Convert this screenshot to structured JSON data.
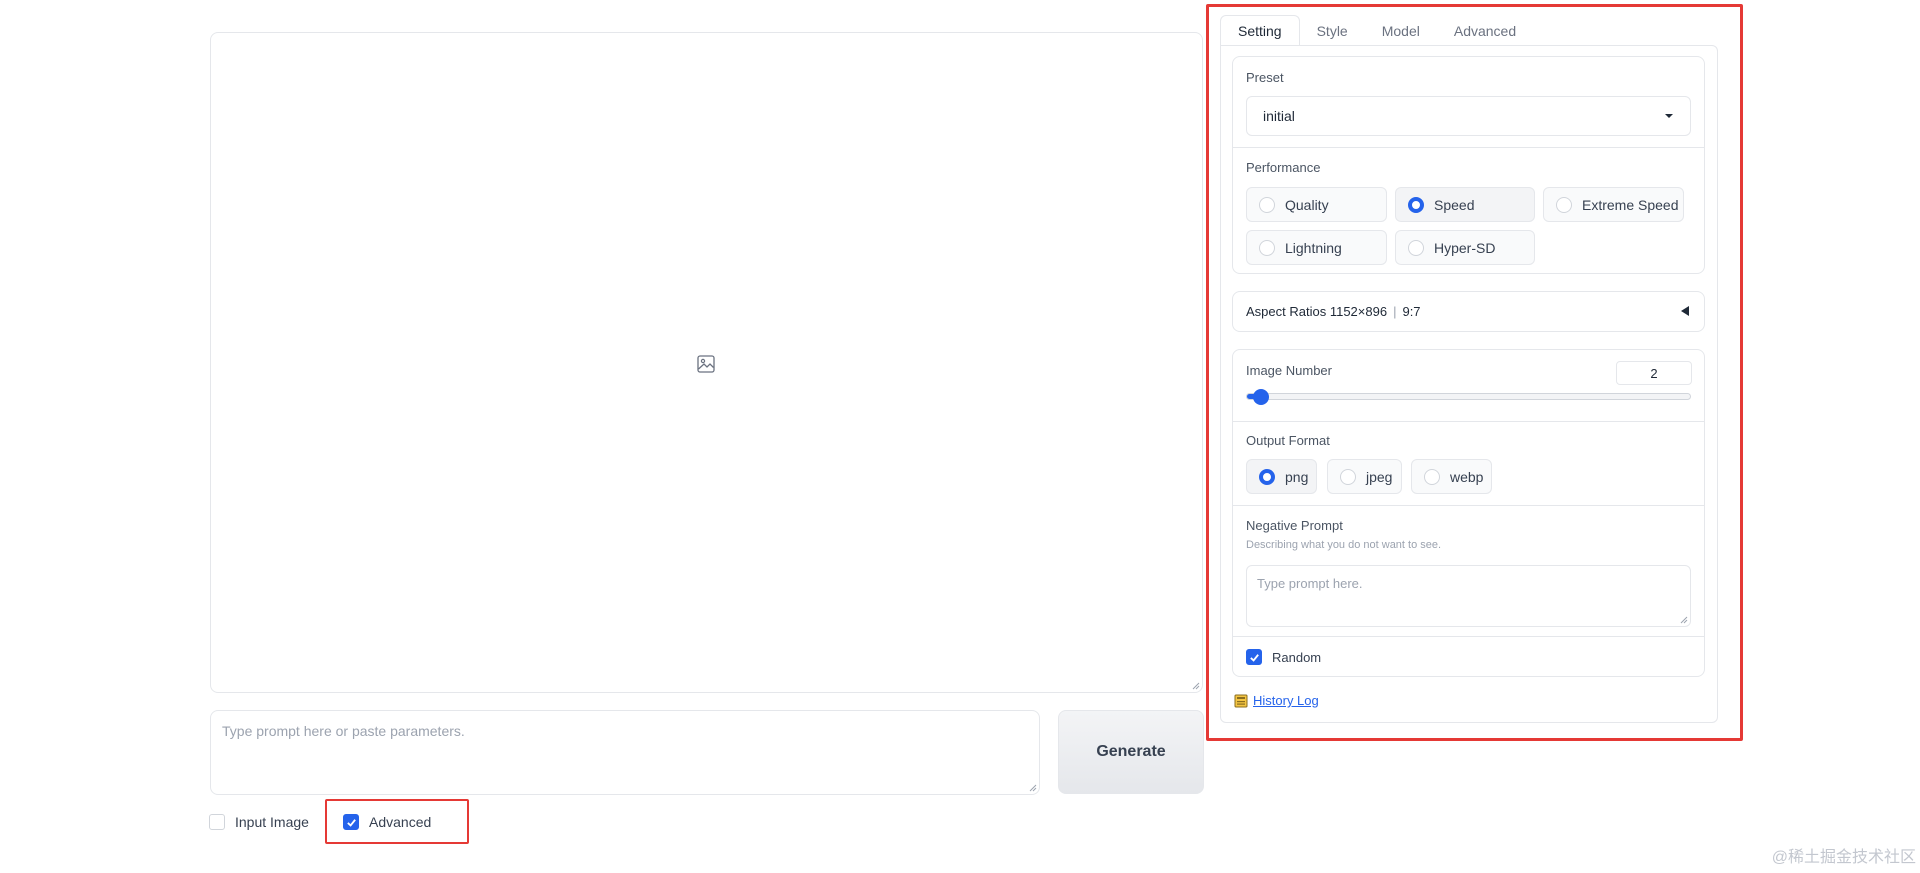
{
  "prompt": {
    "placeholder": "Type prompt here or paste parameters."
  },
  "generate_label": "Generate",
  "bottom_toggles": {
    "input_image": {
      "label": "Input Image",
      "checked": false
    },
    "advanced": {
      "label": "Advanced",
      "checked": true
    }
  },
  "tabs": [
    {
      "label": "Setting",
      "active": true
    },
    {
      "label": "Style",
      "active": false
    },
    {
      "label": "Model",
      "active": false
    },
    {
      "label": "Advanced",
      "active": false
    }
  ],
  "preset": {
    "label": "Preset",
    "value": "initial"
  },
  "performance": {
    "label": "Performance",
    "options": [
      "Quality",
      "Speed",
      "Extreme Speed",
      "Lightning",
      "Hyper-SD"
    ],
    "selected": "Speed"
  },
  "aspect_ratios": {
    "label": "Aspect Ratios",
    "value": "1152×896",
    "ratio": "9:7"
  },
  "image_number": {
    "label": "Image Number",
    "value": "2",
    "min": 1,
    "max": 32
  },
  "output_format": {
    "label": "Output Format",
    "options": [
      "png",
      "jpeg",
      "webp"
    ],
    "selected": "png"
  },
  "negative_prompt": {
    "label": "Negative Prompt",
    "info": "Describing what you do not want to see.",
    "placeholder": "Type prompt here."
  },
  "random": {
    "label": "Random",
    "checked": true
  },
  "history_log": "History Log",
  "watermark": "@稀土掘金技术社区",
  "colors": {
    "accent": "#2563eb",
    "annotation": "#e53935"
  }
}
